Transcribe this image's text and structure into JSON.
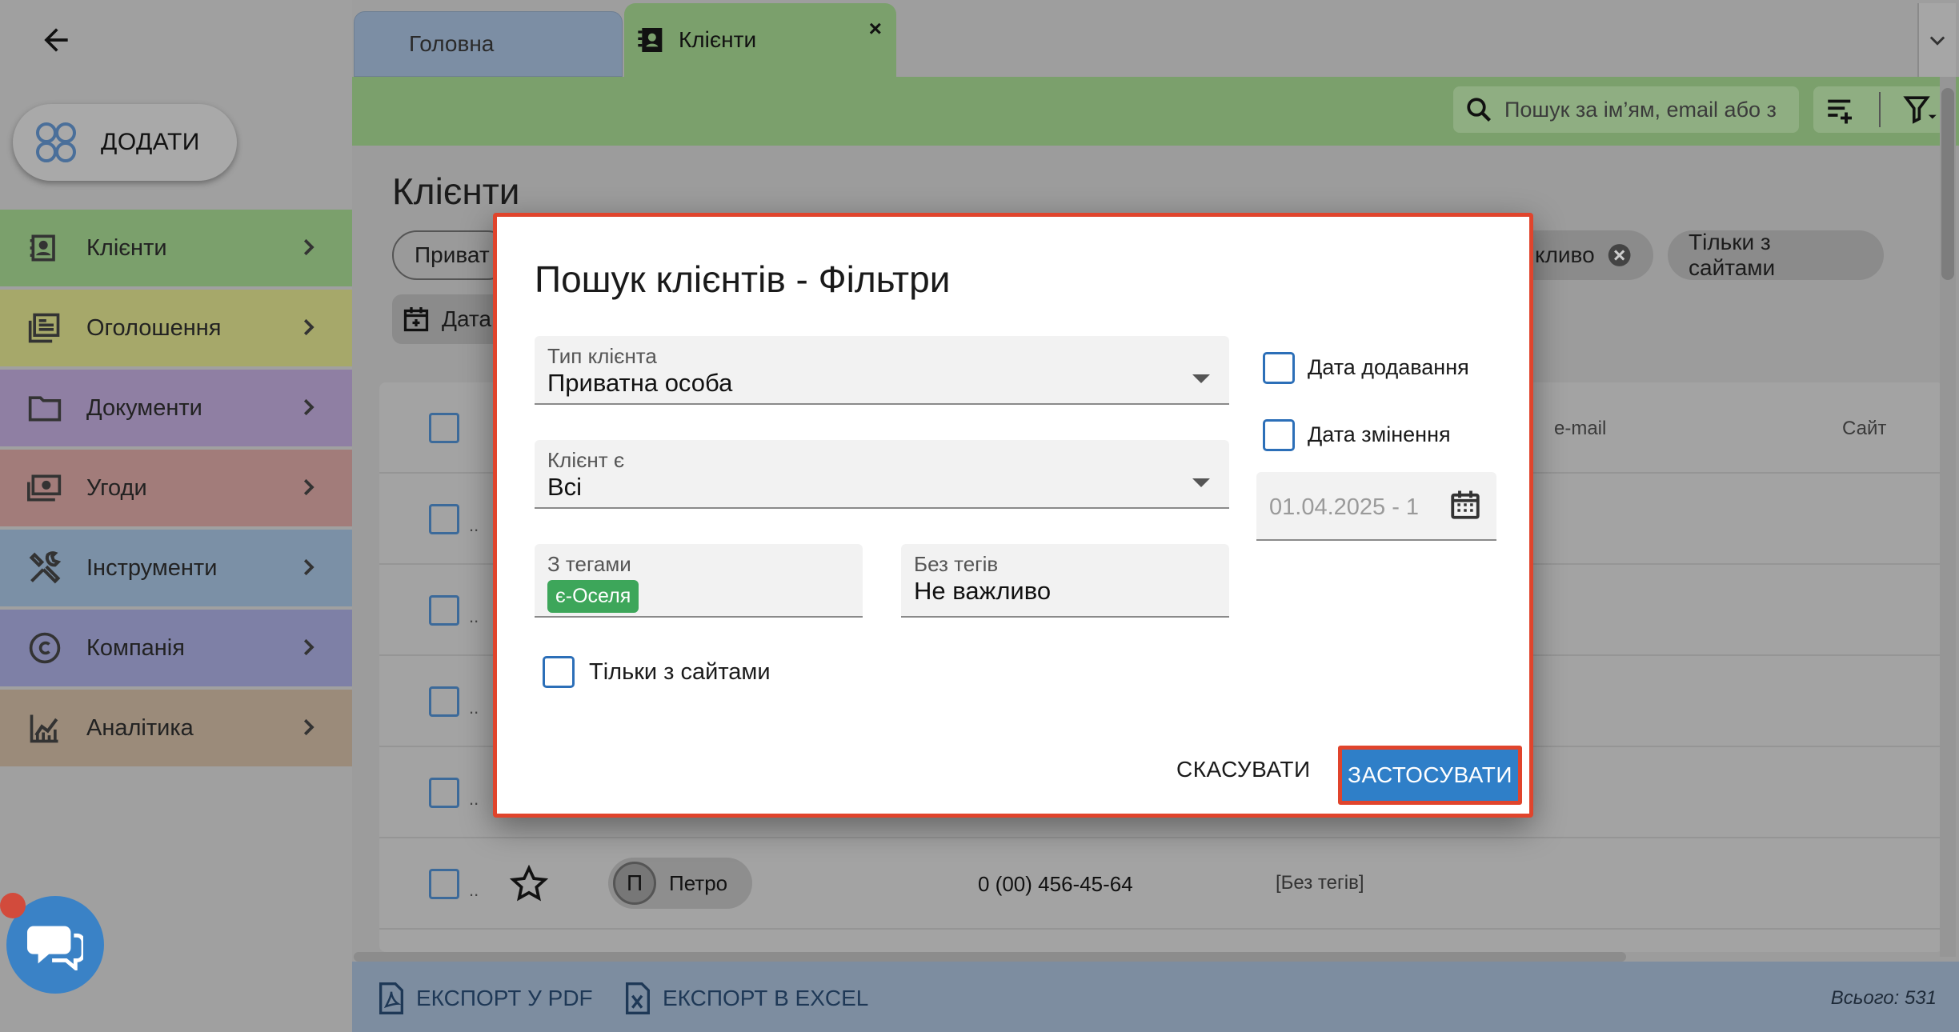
{
  "sidebar": {
    "add_label": "ДОДАТИ",
    "items": [
      {
        "label": "Клієнти",
        "icon": "contacts-icon",
        "color": "#7ba06c"
      },
      {
        "label": "Оголошення",
        "icon": "listings-icon",
        "color": "#a6a86a"
      },
      {
        "label": "Документи",
        "icon": "folder-icon",
        "color": "#8f7fa3"
      },
      {
        "label": "Угоди",
        "icon": "money-icon",
        "color": "#a27c7a"
      },
      {
        "label": "Інструменти",
        "icon": "tools-icon",
        "color": "#7b90a6"
      },
      {
        "label": "Компанія",
        "icon": "copyright-icon",
        "color": "#7e80a6"
      },
      {
        "label": "Аналітика",
        "icon": "analytics-icon",
        "color": "#9b8b7a"
      }
    ]
  },
  "tabs": [
    {
      "label": "Головна"
    },
    {
      "label": "Клієнти",
      "close": "×"
    }
  ],
  "toolbar": {
    "search_placeholder": "Пошук за ім’ям, email або з"
  },
  "page": {
    "title": "Клієнти",
    "chips": [
      "Приват",
      "кливо",
      "Тільки з сайтами",
      "Дата"
    ],
    "columns": [
      "e-mail",
      "Сайт"
    ],
    "visible_row": {
      "avatar": "П",
      "name": "Петро",
      "phone": "0 (00) 456-45-64",
      "tags": "[Без тегів]"
    },
    "ellipsis": ".."
  },
  "footer": {
    "export_pdf": "ЕКСПОРТ У PDF",
    "export_excel": "ЕКСПОРТ В EXCEL",
    "total": "Всього: 531"
  },
  "dialog": {
    "title": "Пошук клієнтів - Фільтри",
    "client_type": {
      "label": "Тип клієнта",
      "value": "Приватна особа"
    },
    "client_is": {
      "label": "Клієнт є",
      "value": "Всі"
    },
    "with_tags": {
      "label": "З тегами",
      "tag": "є-Оселя"
    },
    "without_tags": {
      "label": "Без тегів",
      "value": "Не важливо"
    },
    "only_sites": "Тільки з сайтами",
    "date_added": "Дата додавання",
    "date_changed": "Дата змінення",
    "date_range": "01.04.2025 - 1",
    "cancel": "СКАСУВАТИ",
    "apply": "ЗАСТОСУВАТИ"
  },
  "colors": {
    "accent_green": "#7ba06c",
    "primary_blue": "#2f7fc8",
    "highlight_red": "#e0442c",
    "tag_green": "#3da65a"
  }
}
